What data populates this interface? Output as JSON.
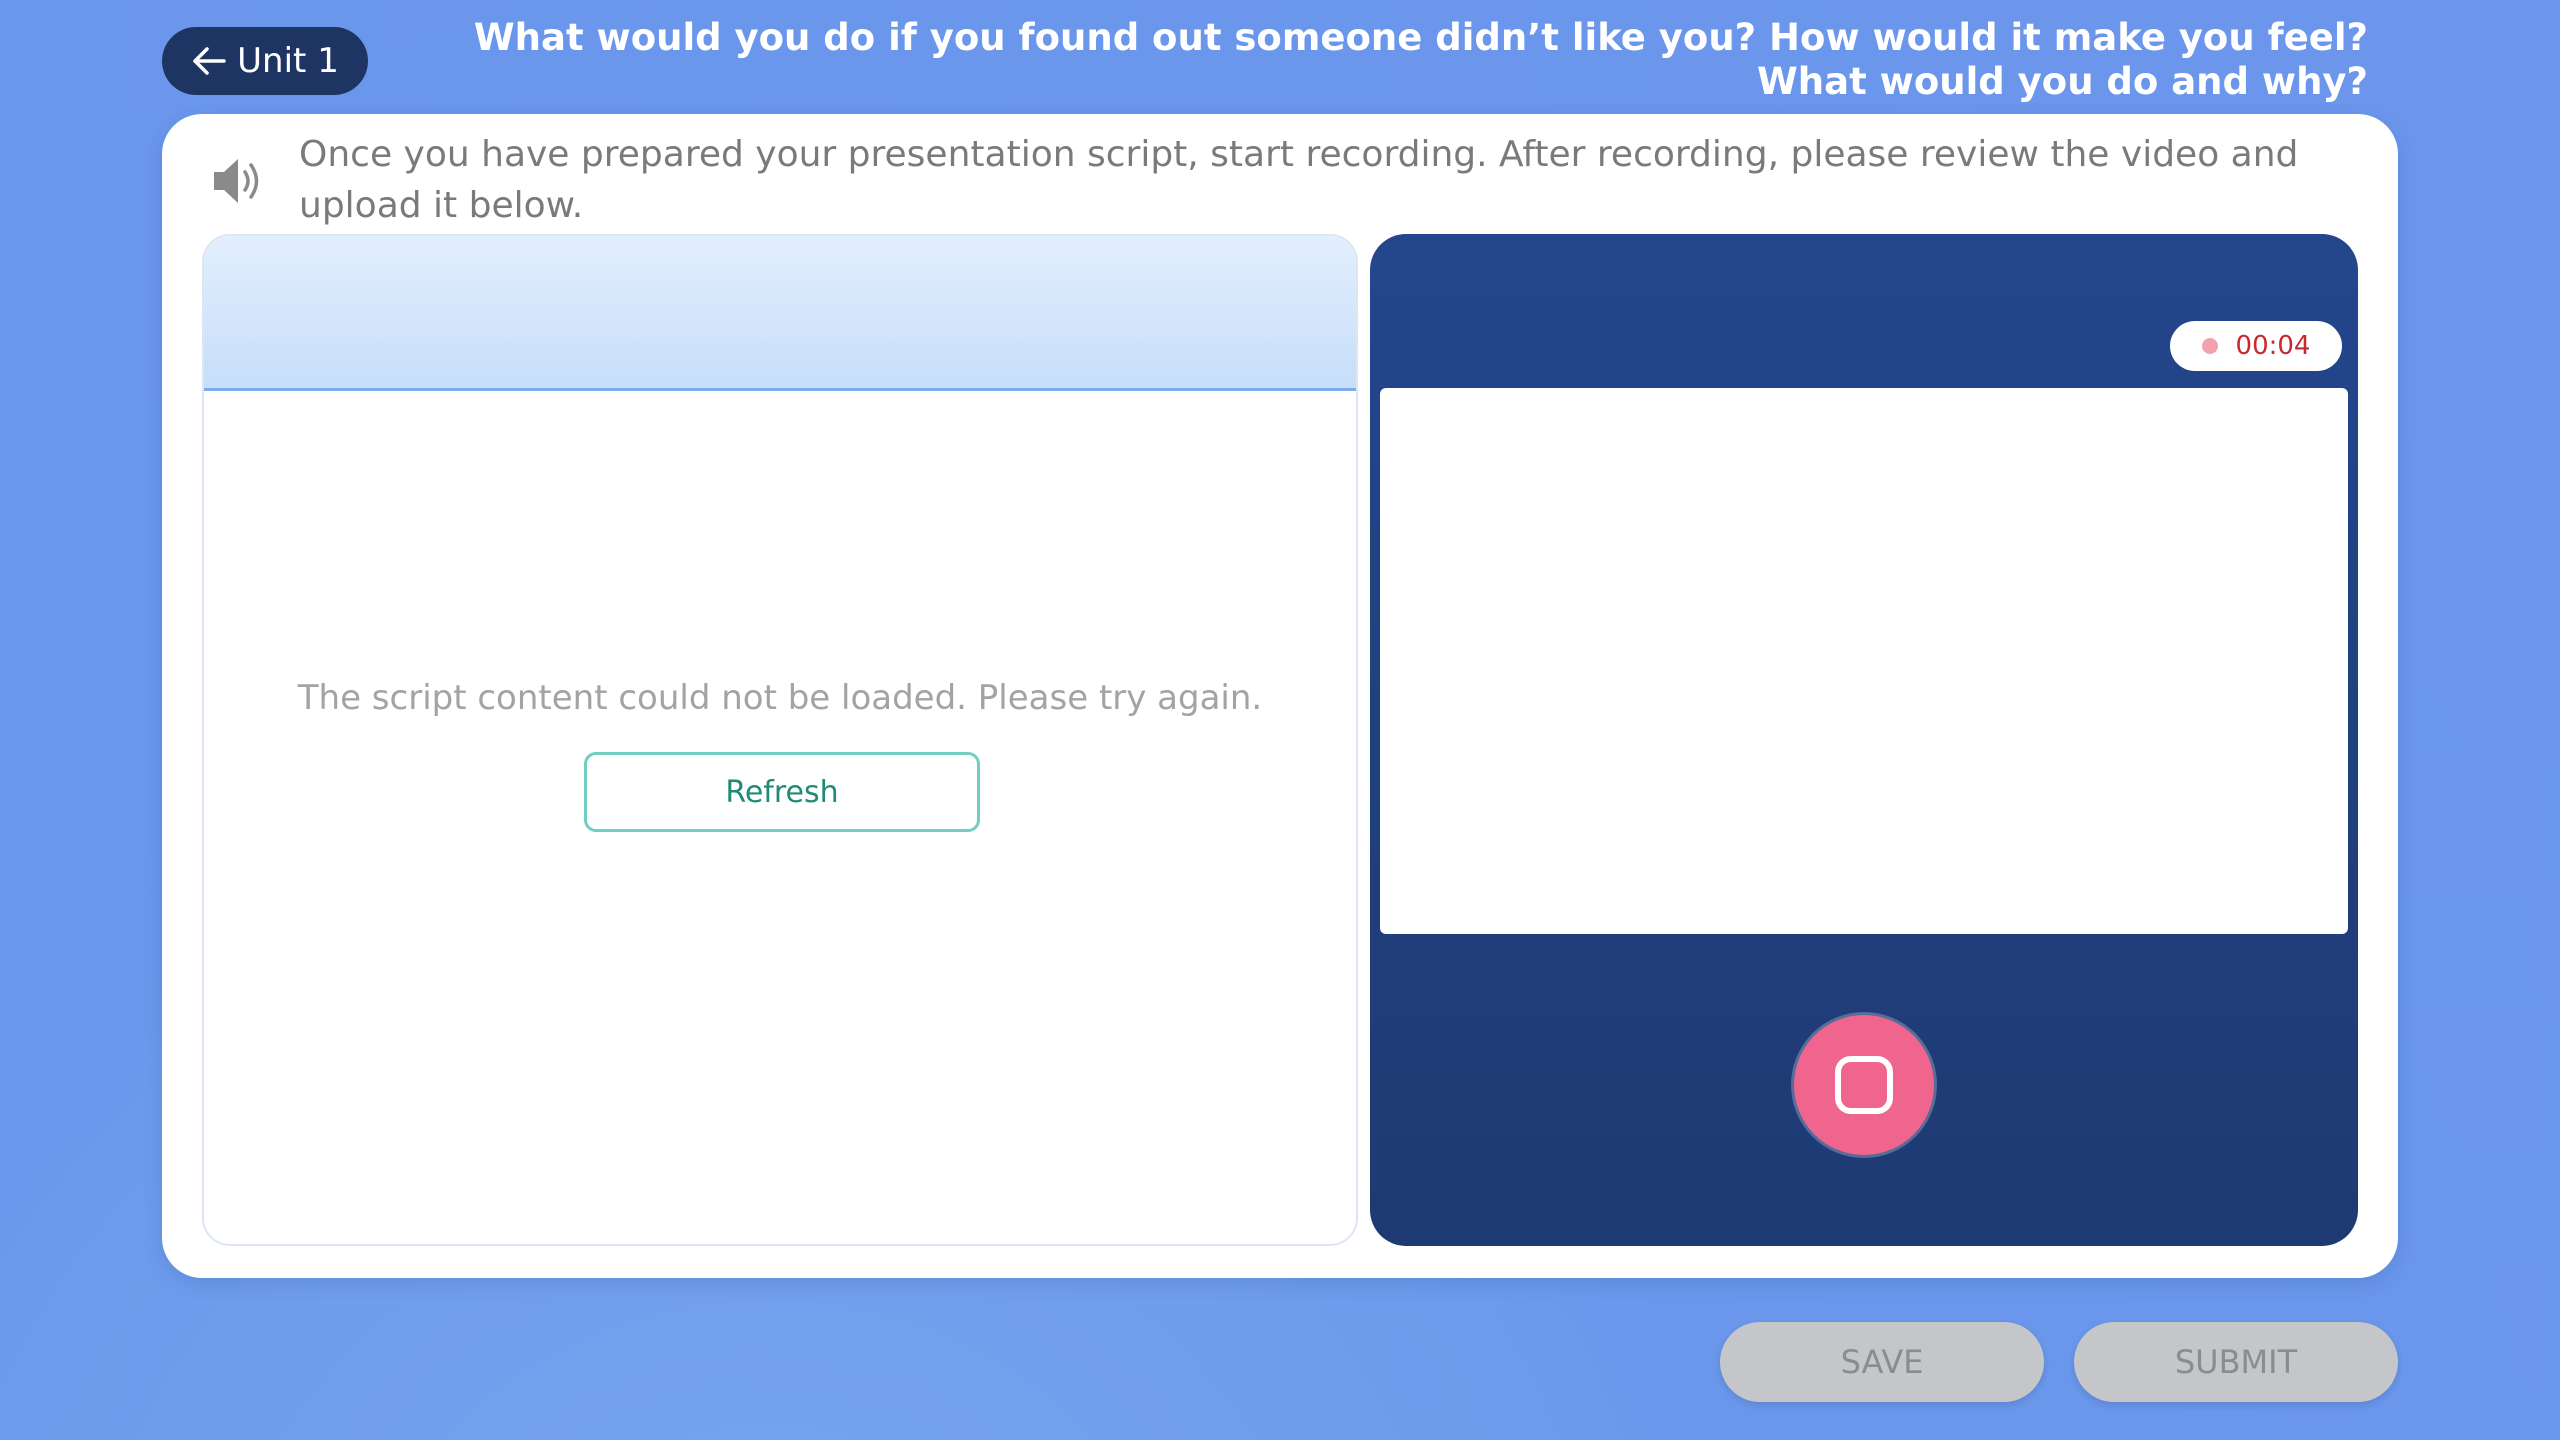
{
  "header": {
    "back_label": "Unit 1",
    "back_icon": "arrow-left-icon",
    "question": "What would you do if you found out someone didn’t like you? How would it make you feel? What would you do and why?"
  },
  "instruction": {
    "icon": "speaker-icon",
    "text": "Once you have prepared your presentation script, start recording. After recording, please review the video and upload it below."
  },
  "script_panel": {
    "error_message": "The script content could not be loaded. Please try again.",
    "refresh_label": "Refresh"
  },
  "record_panel": {
    "timer": "00:04",
    "stop_icon": "stop-icon"
  },
  "footer": {
    "save_label": "SAVE",
    "submit_label": "SUBMIT"
  },
  "colors": {
    "background": "#6b96ec",
    "back_button": "#1e3563",
    "record_panel": "#24468c",
    "stop_button": "#f0658e",
    "refresh_text": "#1f8a75",
    "timer_text": "#c62930",
    "footer_button": "#c4c6ca"
  }
}
